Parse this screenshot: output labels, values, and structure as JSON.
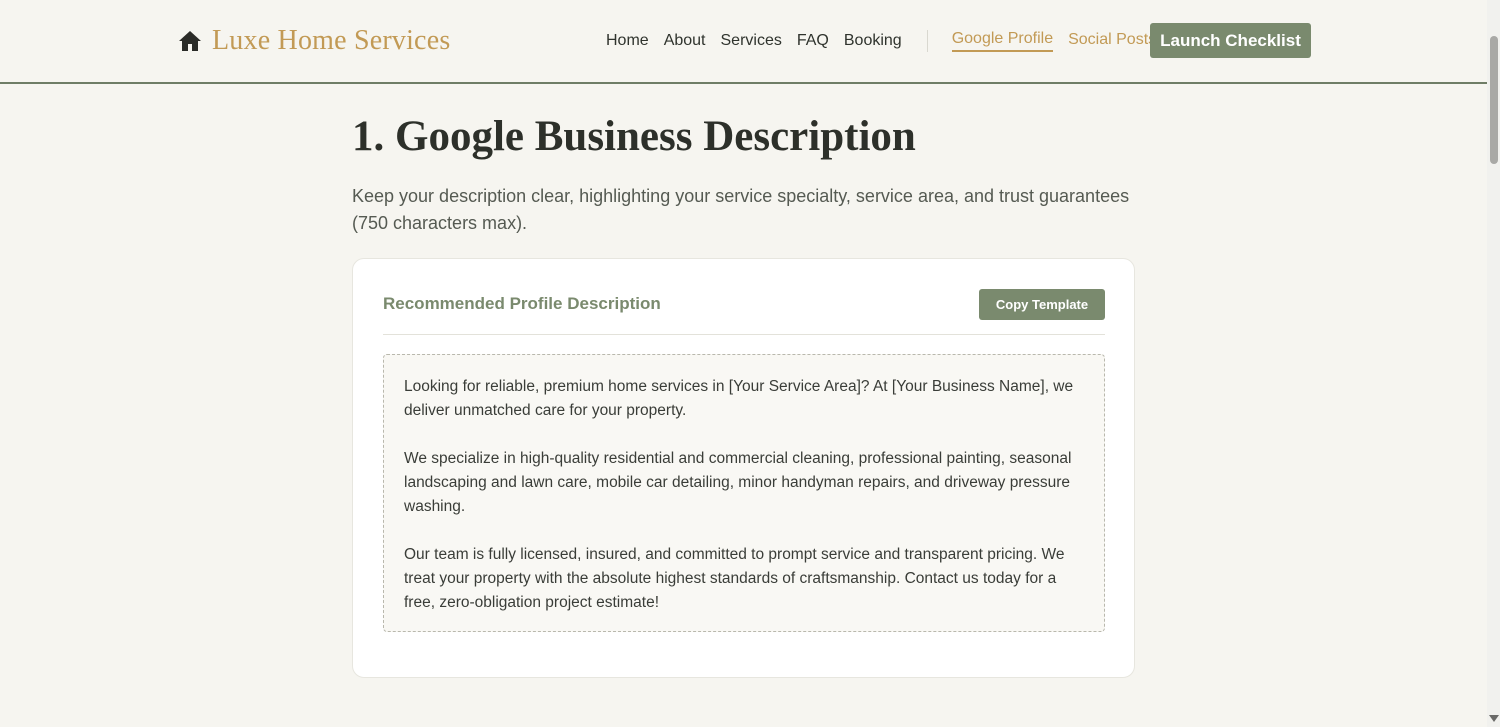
{
  "header": {
    "brand_name": "Luxe Home Services",
    "brand_icon": "home-icon",
    "nav": [
      "Home",
      "About",
      "Services",
      "FAQ",
      "Booking"
    ],
    "accent_links": [
      {
        "label": "Google Profile",
        "active": true
      },
      {
        "label": "Social Posts",
        "active": false
      }
    ],
    "cta_label": "Launch Checklist"
  },
  "main": {
    "title": "1. Google Business Description",
    "intro": "Keep your description clear, highlighting your service specialty, service area, and trust guarantees (750 characters max).",
    "card": {
      "title": "Recommended Profile Description",
      "copy_label": "Copy Template",
      "paragraphs": [
        "Looking for reliable, premium home services in [Your Service Area]? At [Your Business Name], we deliver unmatched care for your property.",
        "We specialize in high-quality residential and commercial cleaning, professional painting, seasonal landscaping and lawn care, mobile car detailing, minor handyman repairs, and driveway pressure washing.",
        "Our team is fully licensed, insured, and committed to prompt service and transparent pricing. We treat your property with the absolute highest standards of craftsmanship. Contact us today for a free, zero-obligation project estimate!"
      ]
    }
  },
  "colors": {
    "accent_gold": "#c29a55",
    "sage": "#7a8a6e",
    "background": "#f6f5f0"
  }
}
